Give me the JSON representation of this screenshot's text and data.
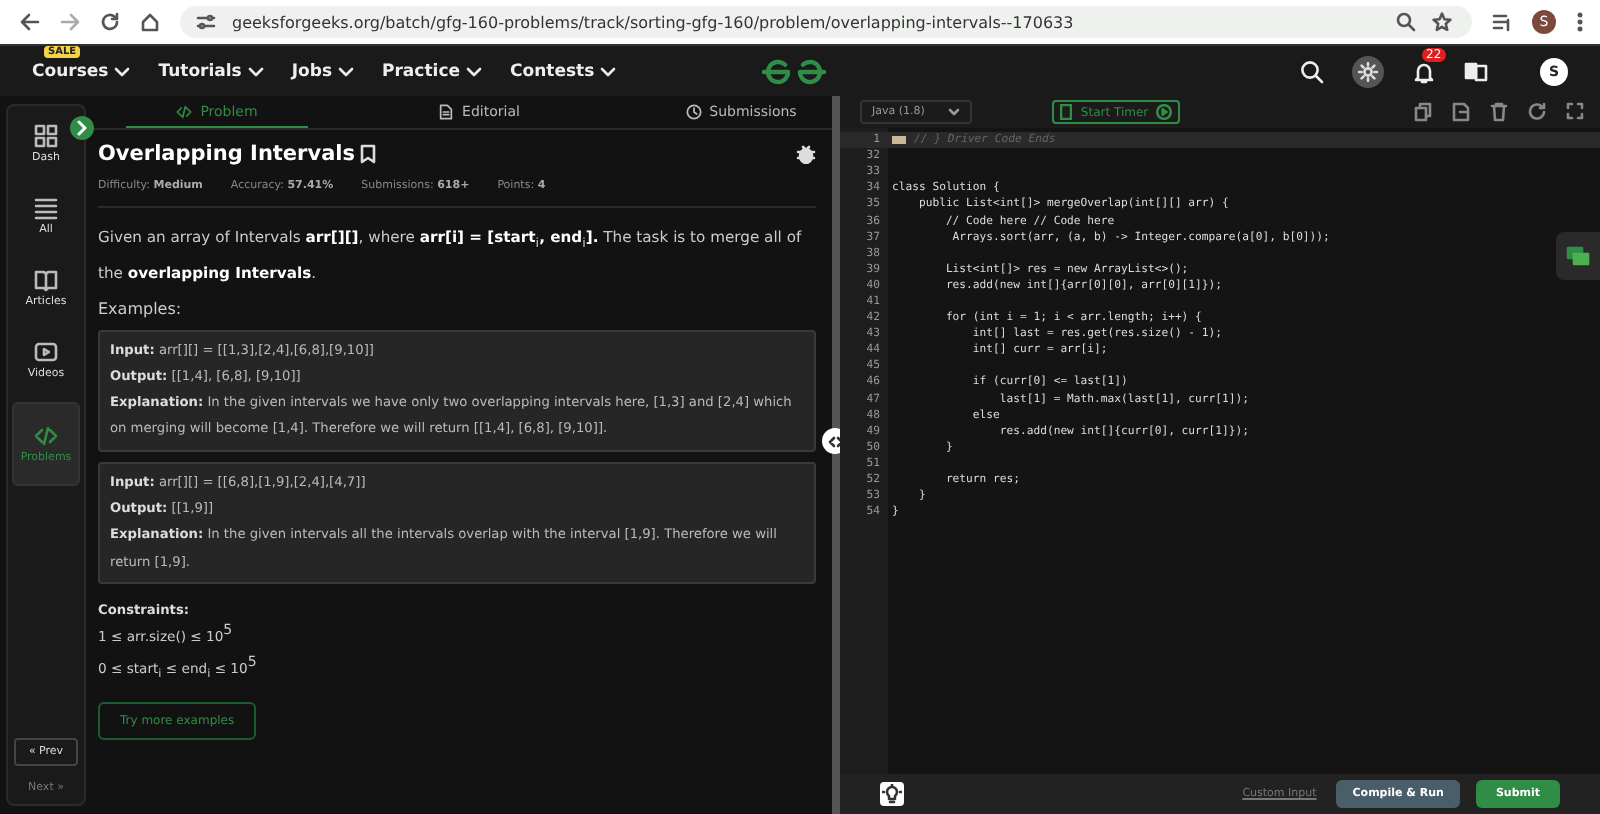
{
  "browser": {
    "url": "geeksforgeeks.org/batch/gfg-160-problems/track/sorting-gfg-160/problem/overlapping-intervals--170633",
    "profile": "S"
  },
  "nav": {
    "badge": "SALE",
    "menus": [
      "Courses",
      "Tutorials",
      "Jobs",
      "Practice",
      "Contests"
    ],
    "notifications": "22",
    "avatar": "S"
  },
  "sidebar": {
    "items": [
      {
        "label": "Dash",
        "selected": false
      },
      {
        "label": "All",
        "selected": false
      },
      {
        "label": "Articles",
        "selected": false
      },
      {
        "label": "Videos",
        "selected": false
      },
      {
        "label": "Problems",
        "selected": true
      }
    ],
    "prev": "« Prev",
    "next": "Next »"
  },
  "tabs": [
    {
      "label": "Problem",
      "selected": true
    },
    {
      "label": "Editorial",
      "selected": false
    },
    {
      "label": "Submissions",
      "selected": false
    }
  ],
  "problem": {
    "title": "Overlapping Intervals",
    "meta": [
      {
        "label": "Difficulty:",
        "value": "Medium"
      },
      {
        "label": "Accuracy:",
        "value": "57.41%"
      },
      {
        "label": "Submissions:",
        "value": "618+"
      },
      {
        "label": "Points:",
        "value": "4"
      }
    ],
    "description": "Given an array of Intervals **arr[][]**, where **arr[i] = [start**$_{i}$**, end**$_{i}$**].** The task is to merge all of the **overlapping Intervals**.",
    "examples_heading": "Examples:",
    "examples": [
      {
        "input_label": "Input:",
        "input": "arr[][] = [[1,3],[2,4],[6,8],[9,10]]",
        "output_label": "Output:",
        "output": "[[1,4], [6,8], [9,10]]",
        "explanation_label": "Explanation:",
        "explanation": "In the given intervals we have only two overlapping intervals here, [1,3] and [2,4] which on merging will become [1,4]. Therefore we will return [[1,4], [6,8], [9,10]]."
      },
      {
        "input_label": "Input:",
        "input": "arr[][] = [[6,8],[1,9],[2,4],[4,7]]",
        "output_label": "Output:",
        "output": "[[1,9]]",
        "explanation_label": "Explanation:",
        "explanation": "In the given intervals all the intervals overlap with the interval [1,9]. Therefore we will return [1,9]."
      }
    ],
    "constraints_heading": "Constraints:",
    "constraints": [
      "1 ≤ arr.size() ≤ 10$^{5}$",
      "0 ≤ start$_{i}$ ≤ end$_{i}$ ≤ 10$^{5}$"
    ],
    "more_button": "Try more examples"
  },
  "editor": {
    "language": "Java (1.8)",
    "timer": "Start Timer",
    "lines": [
      {
        "n": "1",
        "folded": true,
        "code": "// } Driver Code Ends"
      },
      {
        "n": "32",
        "folded": false
      },
      {
        "n": "33",
        "folded": false
      },
      {
        "n": "34",
        "folded": false,
        "code": "class Solution {"
      },
      {
        "n": "35",
        "folded": false,
        "code": "    public List<int[]> mergeOverlap(int[][] arr) {"
      },
      {
        "n": "36",
        "folded": false,
        "code": "        // Code here // Code here"
      },
      {
        "n": "37",
        "folded": false,
        "code": "         Arrays.sort(arr, (a, b) -> Integer.compare(a[0], b[0]));"
      },
      {
        "n": "38",
        "folded": false
      },
      {
        "n": "39",
        "folded": false,
        "code": "        List<int[]> res = new ArrayList<>();"
      },
      {
        "n": "40",
        "folded": false,
        "code": "        res.add(new int[]{arr[0][0], arr[0][1]});"
      },
      {
        "n": "41",
        "folded": false
      },
      {
        "n": "42",
        "folded": false,
        "code": "        for (int i = 1; i < arr.length; i++) {"
      },
      {
        "n": "43",
        "folded": false,
        "code": "            int[] last = res.get(res.size() - 1);"
      },
      {
        "n": "44",
        "folded": false,
        "code": "            int[] curr = arr[i];"
      },
      {
        "n": "45",
        "folded": false
      },
      {
        "n": "46",
        "folded": false,
        "code": "            if (curr[0] <= last[1])"
      },
      {
        "n": "47",
        "folded": false,
        "code": "                last[1] = Math.max(last[1], curr[1]);"
      },
      {
        "n": "48",
        "folded": false,
        "code": "            else"
      },
      {
        "n": "49",
        "folded": false,
        "code": "                res.add(new int[]{curr[0], curr[1]});"
      },
      {
        "n": "50",
        "folded": false,
        "code": "        }"
      },
      {
        "n": "51",
        "folded": false
      },
      {
        "n": "52",
        "folded": false,
        "code": "        return res;"
      },
      {
        "n": "53",
        "folded": false,
        "code": "    }"
      },
      {
        "n": "54",
        "folded": false,
        "code": "}"
      }
    ],
    "custom_input": "Custom Input",
    "compile": "Compile & Run",
    "submit": "Submit"
  }
}
